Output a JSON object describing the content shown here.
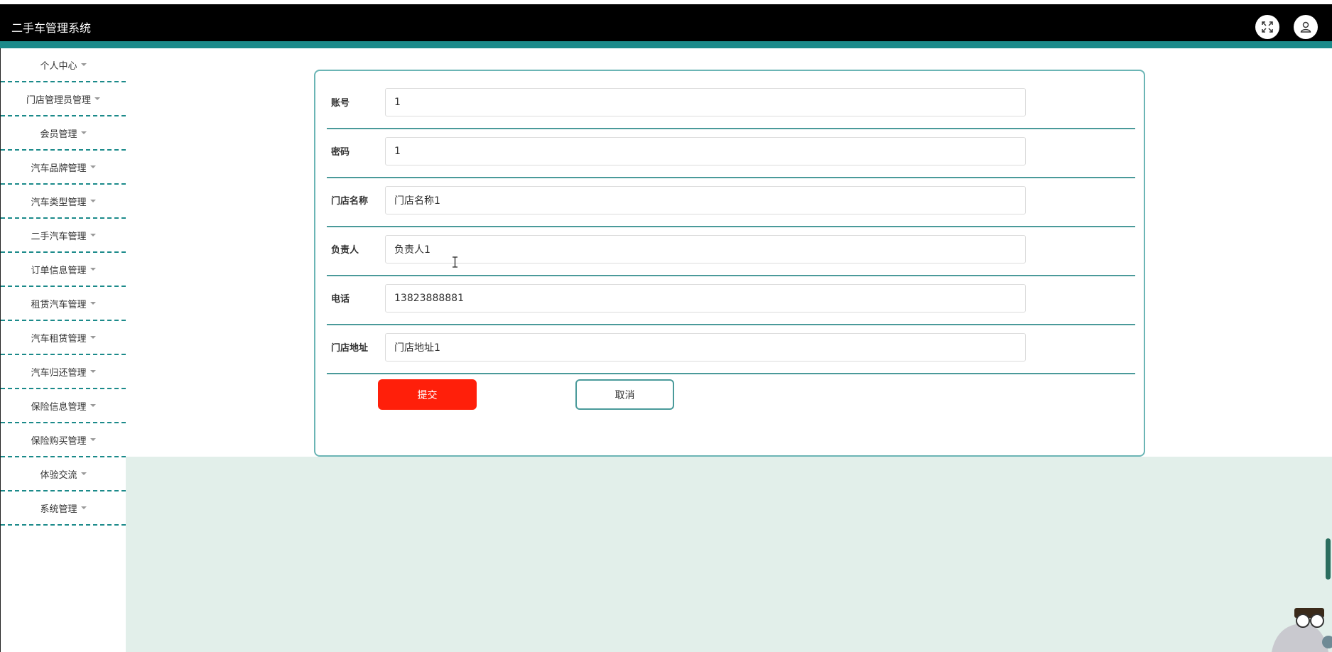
{
  "app": {
    "title": "二手车管理系统"
  },
  "header": {
    "fullscreen_icon": "fullscreen-icon",
    "user_icon": "user-icon"
  },
  "sidebar": {
    "items": [
      {
        "label": "个人中心"
      },
      {
        "label": "门店管理员管理"
      },
      {
        "label": "会员管理"
      },
      {
        "label": "汽车品牌管理"
      },
      {
        "label": "汽车类型管理"
      },
      {
        "label": "二手汽车管理"
      },
      {
        "label": "订单信息管理"
      },
      {
        "label": "租赁汽车管理"
      },
      {
        "label": "汽车租赁管理"
      },
      {
        "label": "汽车归还管理"
      },
      {
        "label": "保险信息管理"
      },
      {
        "label": "保险购买管理"
      },
      {
        "label": "体验交流"
      },
      {
        "label": "系统管理"
      }
    ]
  },
  "form": {
    "fields": [
      {
        "label": "账号",
        "value": "1"
      },
      {
        "label": "密码",
        "value": "1"
      },
      {
        "label": "门店名称",
        "value": "门店名称1"
      },
      {
        "label": "负责人",
        "value": "负责人1"
      },
      {
        "label": "电话",
        "value": "13823888881"
      },
      {
        "label": "门店地址",
        "value": "门店地址1"
      }
    ],
    "submit_label": "提交",
    "cancel_label": "取消"
  },
  "colors": {
    "topbar": "#000000",
    "accent": "#1b8a8a",
    "submit": "#ff1f0a",
    "content_bg": "#e2efea"
  }
}
